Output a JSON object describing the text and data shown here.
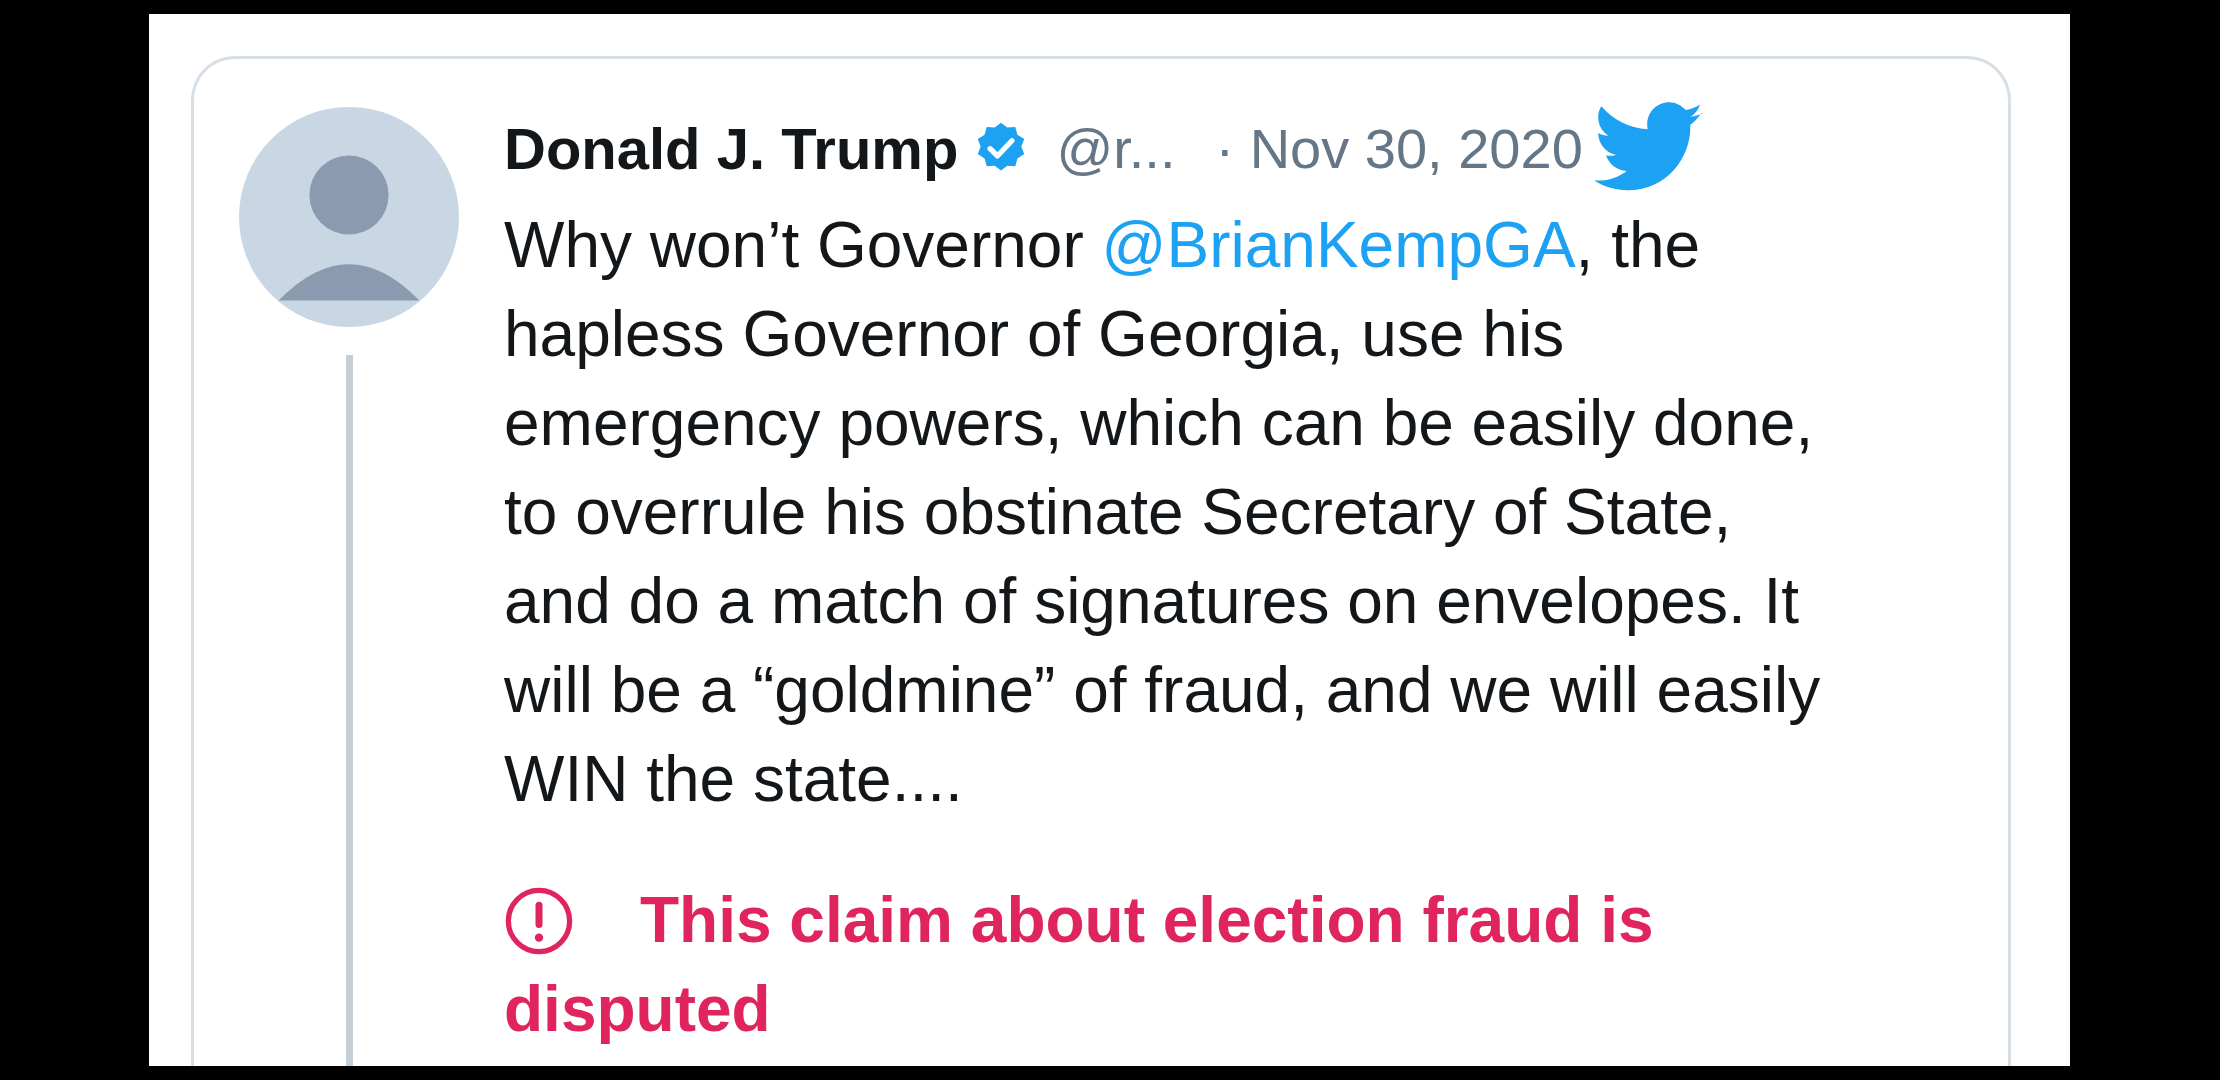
{
  "tweet": {
    "author": {
      "name": "Donald J. Trump",
      "verified": true,
      "handle": "@r...",
      "date": "· Nov 30, 2020"
    },
    "text": [
      {
        "kind": "text",
        "value": "Why won’t Governor "
      },
      {
        "kind": "mention",
        "value": "@BrianKempGA"
      },
      {
        "kind": "text",
        "value": ", the hapless Governor of Georgia, use his emergency powers, which can be easily done, to overrule his obstinate Secretary of State, and do a match of signatures on envelopes. It will be a “goldmine” of fraud, and we will easily WIN the state...."
      }
    ],
    "notice": "This claim about election fraud is disputed"
  }
}
